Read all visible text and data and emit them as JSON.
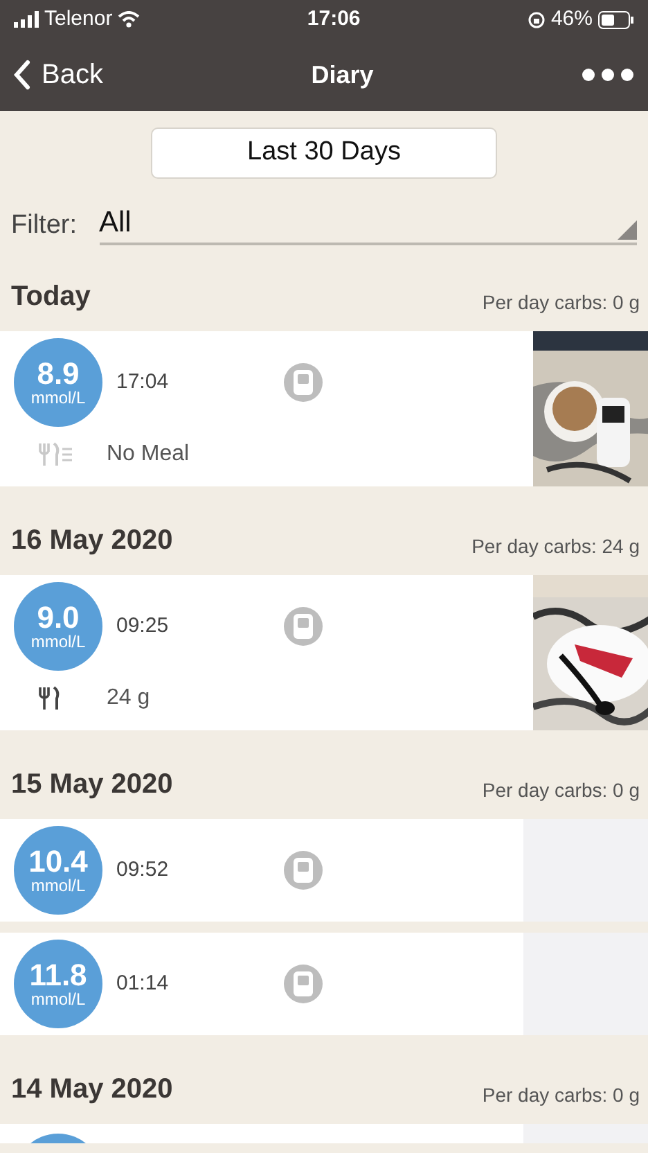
{
  "status_bar": {
    "carrier": "Telenor",
    "time": "17:06",
    "battery": "46%"
  },
  "nav": {
    "back": "Back",
    "title": "Diary"
  },
  "range_button": "Last 30 Days",
  "filter": {
    "label": "Filter:",
    "value": "All"
  },
  "days": [
    {
      "date": "Today",
      "carbs": "Per day carbs: 0 g",
      "entries": [
        {
          "value": "8.9",
          "unit": "mmol/L",
          "time": "17:04",
          "meal": {
            "kind": "none",
            "text": "No Meal"
          }
        }
      ]
    },
    {
      "date": "16 May 2020",
      "carbs": "Per day carbs: 24 g",
      "entries": [
        {
          "value": "9.0",
          "unit": "mmol/L",
          "time": "09:25",
          "meal": {
            "kind": "meal",
            "text": "24 g"
          }
        }
      ]
    },
    {
      "date": "15 May 2020",
      "carbs": "Per day carbs: 0 g",
      "entries": [
        {
          "value": "10.4",
          "unit": "mmol/L",
          "time": "09:52",
          "media": {
            "kind": "empty"
          }
        },
        {
          "value": "11.8",
          "unit": "mmol/L",
          "time": "01:14",
          "media": {
            "kind": "empty"
          }
        }
      ]
    },
    {
      "date": "14 May 2020",
      "carbs": "Per day carbs: 0 g",
      "entries": [
        {
          "media": {
            "kind": "empty"
          }
        }
      ]
    }
  ]
}
